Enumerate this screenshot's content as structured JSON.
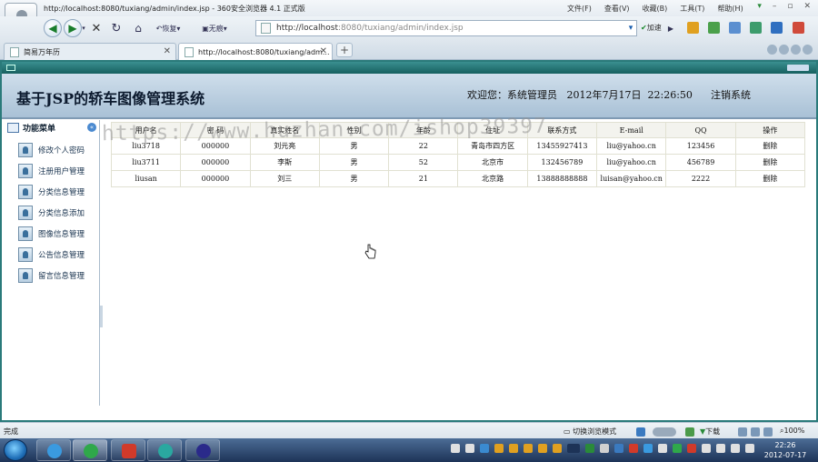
{
  "browser": {
    "window_title": "http://localhost:8080/tuxiang/admin/index.jsp - 360安全浏览器 4.1 正式版",
    "menu": [
      "文件(F)",
      "查看(V)",
      "收藏(B)",
      "工具(T)",
      "帮助(H)"
    ],
    "back_label": "恢复",
    "nosound_label": "无痕",
    "address": {
      "host": "http://localhost",
      "port": ":8080",
      "path": "/tuxiang/admin/index.jsp"
    },
    "accelerate_label": "加速",
    "tabs": [
      {
        "title": "简易万年历"
      },
      {
        "title": "http://localhost:8080/tuxiang/adm..."
      }
    ],
    "status_text": "完成",
    "mode_label": "切换浏览模式",
    "download_label": "下载",
    "zoom": "100%"
  },
  "app": {
    "title": "基于JSP的轿车图像管理系统",
    "welcome_prefix": "欢迎您：",
    "user_role": "系统管理员",
    "date": "2012年7月17日",
    "time": "22:26:50",
    "logout_label": "注销系统"
  },
  "sidebar": {
    "heading": "功能菜单",
    "items": [
      {
        "label": "修改个人密码"
      },
      {
        "label": "注册用户管理"
      },
      {
        "label": "分类信息管理"
      },
      {
        "label": "分类信息添加"
      },
      {
        "label": "图像信息管理"
      },
      {
        "label": "公告信息管理"
      },
      {
        "label": "留言信息管理"
      }
    ]
  },
  "table": {
    "columns": [
      "用户名",
      "密 码",
      "真实姓名",
      "性别",
      "年龄",
      "住址",
      "联系方式",
      "E-mail",
      "QQ",
      "操作"
    ],
    "rows": [
      {
        "username": "liu3718",
        "password": "000000",
        "realname": "刘元亮",
        "sex": "男",
        "age": "22",
        "address": "青岛市四方区",
        "phone": "13455927413",
        "email": "liu@yahoo.cn",
        "qq": "123456",
        "action": "删除"
      },
      {
        "username": "liu3711",
        "password": "000000",
        "realname": "李斯",
        "sex": "男",
        "age": "52",
        "address": "北京市",
        "phone": "132456789",
        "email": "liu@yahoo.cn",
        "qq": "456789",
        "action": "删除"
      },
      {
        "username": "liusan",
        "password": "000000",
        "realname": "刘三",
        "sex": "男",
        "age": "21",
        "address": "北京路",
        "phone": "13888888888",
        "email": "luisan@yahoo.cn",
        "qq": "2222",
        "action": "删除"
      }
    ]
  },
  "watermark": "https://www.huzhan.com/ishop39397",
  "taskbar": {
    "clock_time": "22:26",
    "clock_date": "2012-07-17"
  },
  "colors": {
    "header_bg": "#b8cde0",
    "deco_bar": "#17605f",
    "table_header": "#f3f3ee",
    "taskbar": "#1d3357"
  }
}
